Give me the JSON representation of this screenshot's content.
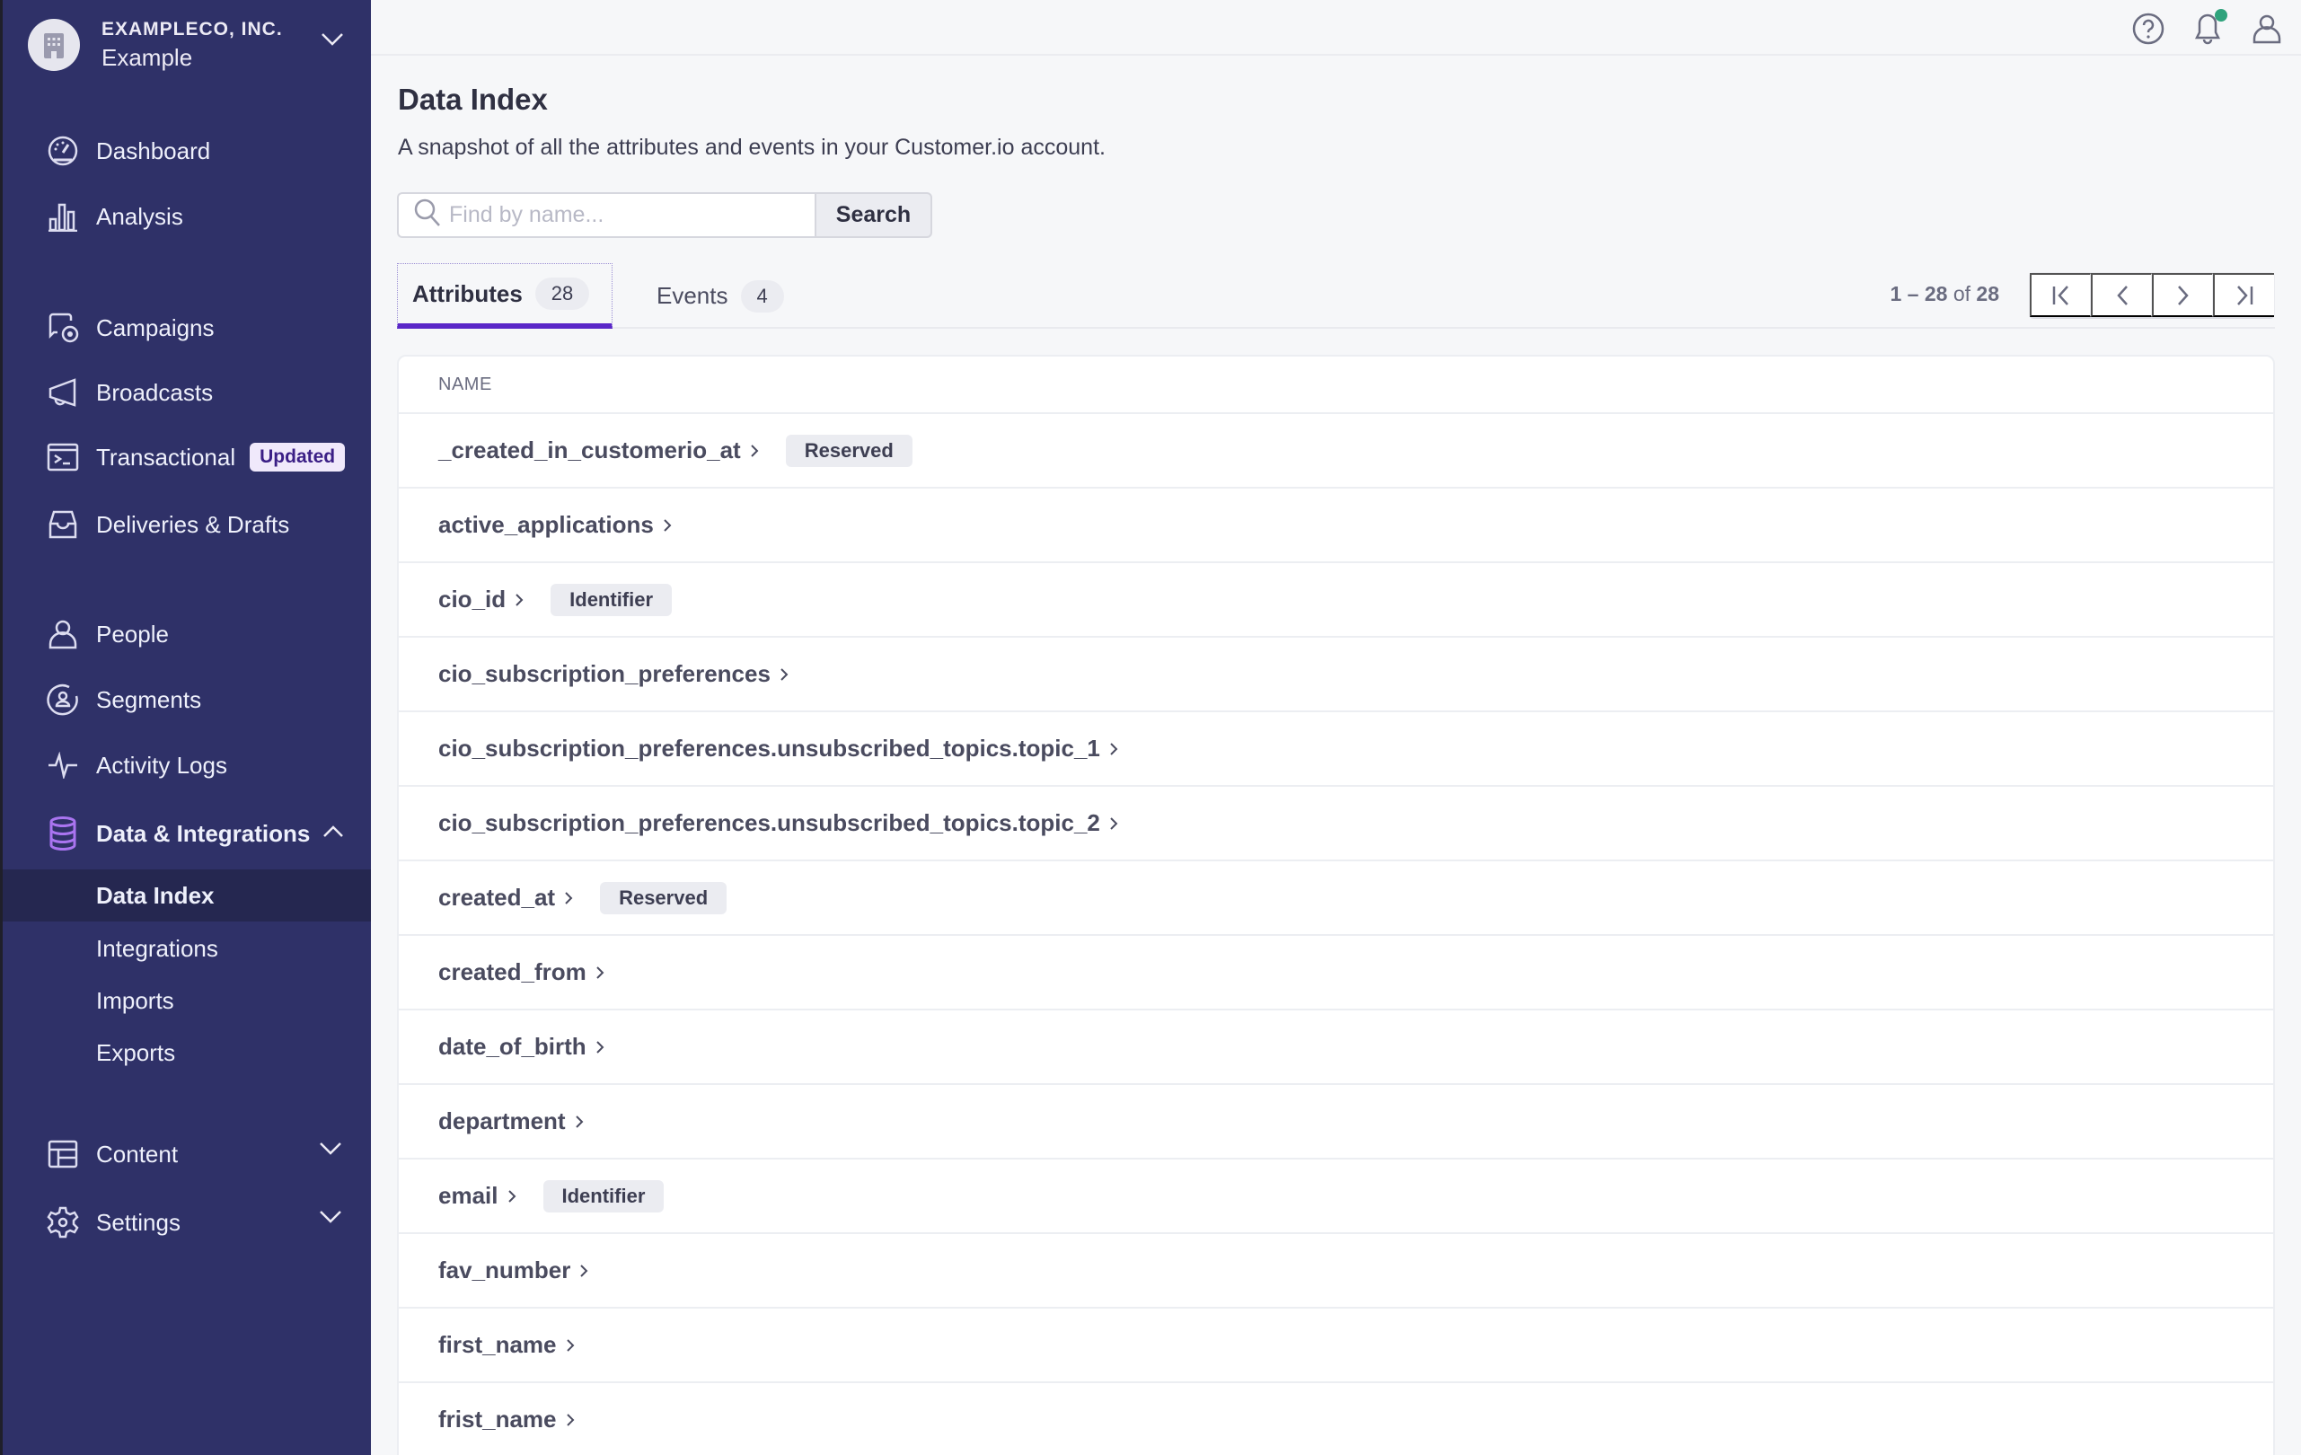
{
  "org": {
    "company": "EXAMPLECO, INC.",
    "workspace": "Example"
  },
  "sidebar": {
    "items": [
      {
        "label": "Dashboard",
        "icon": "gauge-icon"
      },
      {
        "label": "Analysis",
        "icon": "bar-chart-icon"
      },
      {
        "label": "Campaigns",
        "icon": "campaign-icon"
      },
      {
        "label": "Broadcasts",
        "icon": "megaphone-icon"
      },
      {
        "label": "Transactional",
        "icon": "terminal-icon",
        "badge": "Updated"
      },
      {
        "label": "Deliveries & Drafts",
        "icon": "inbox-icon"
      },
      {
        "label": "People",
        "icon": "person-icon"
      },
      {
        "label": "Segments",
        "icon": "segment-icon"
      },
      {
        "label": "Activity Logs",
        "icon": "pulse-icon"
      },
      {
        "label": "Data & Integrations",
        "icon": "database-icon",
        "expanded": true
      },
      {
        "label": "Content",
        "icon": "layout-icon"
      },
      {
        "label": "Settings",
        "icon": "gear-icon"
      }
    ],
    "subitems": [
      {
        "label": "Data Index",
        "active": true
      },
      {
        "label": "Integrations"
      },
      {
        "label": "Imports"
      },
      {
        "label": "Exports"
      }
    ]
  },
  "colors": {
    "sidebar_bg": "#2f3168",
    "accent": "#5a27c8",
    "notification": "#2fa37c",
    "database_icon": "#a974f0"
  },
  "main": {
    "title": "Data Index",
    "subtitle": "A snapshot of all the attributes and events in your Customer.io account.",
    "search": {
      "placeholder": "Find by name...",
      "value": "",
      "button": "Search"
    },
    "tabs": [
      {
        "label": "Attributes",
        "count": "28",
        "active": true
      },
      {
        "label": "Events",
        "count": "4",
        "active": false
      }
    ],
    "pagination": {
      "start": "1",
      "end": "28",
      "of": "of",
      "total": "28"
    },
    "table": {
      "column": "NAME",
      "rows": [
        {
          "name": "_created_in_customerio_at",
          "tag": "Reserved"
        },
        {
          "name": "active_applications"
        },
        {
          "name": "cio_id",
          "tag": "Identifier"
        },
        {
          "name": "cio_subscription_preferences"
        },
        {
          "name": "cio_subscription_preferences.unsubscribed_topics.topic_1"
        },
        {
          "name": "cio_subscription_preferences.unsubscribed_topics.topic_2"
        },
        {
          "name": "created_at",
          "tag": "Reserved"
        },
        {
          "name": "created_from"
        },
        {
          "name": "date_of_birth"
        },
        {
          "name": "department"
        },
        {
          "name": "email",
          "tag": "Identifier"
        },
        {
          "name": "fav_number"
        },
        {
          "name": "first_name"
        },
        {
          "name": "frist_name"
        }
      ]
    }
  }
}
